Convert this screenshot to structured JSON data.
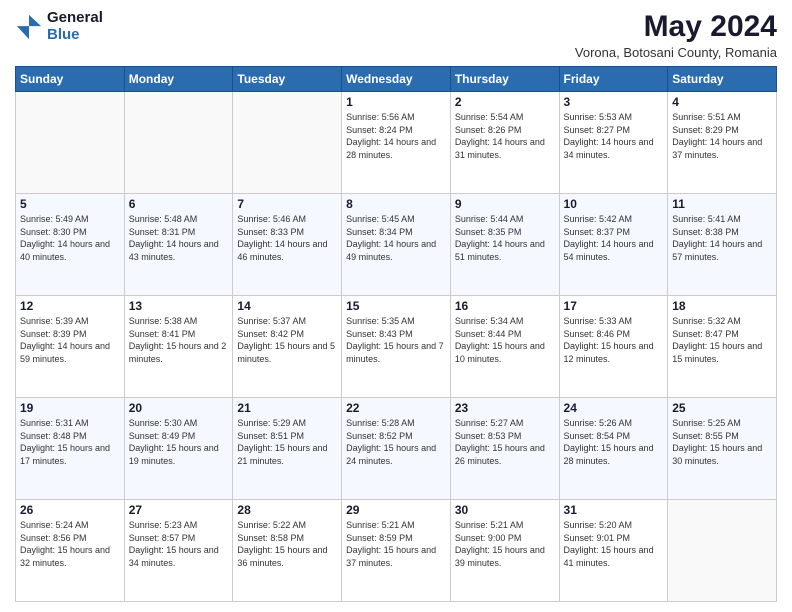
{
  "logo": {
    "general": "General",
    "blue": "Blue"
  },
  "header": {
    "month_year": "May 2024",
    "location": "Vorona, Botosani County, Romania"
  },
  "days_of_week": [
    "Sunday",
    "Monday",
    "Tuesday",
    "Wednesday",
    "Thursday",
    "Friday",
    "Saturday"
  ],
  "weeks": [
    [
      {
        "day": "",
        "info": ""
      },
      {
        "day": "",
        "info": ""
      },
      {
        "day": "",
        "info": ""
      },
      {
        "day": "1",
        "info": "Sunrise: 5:56 AM\nSunset: 8:24 PM\nDaylight: 14 hours and 28 minutes."
      },
      {
        "day": "2",
        "info": "Sunrise: 5:54 AM\nSunset: 8:26 PM\nDaylight: 14 hours and 31 minutes."
      },
      {
        "day": "3",
        "info": "Sunrise: 5:53 AM\nSunset: 8:27 PM\nDaylight: 14 hours and 34 minutes."
      },
      {
        "day": "4",
        "info": "Sunrise: 5:51 AM\nSunset: 8:29 PM\nDaylight: 14 hours and 37 minutes."
      }
    ],
    [
      {
        "day": "5",
        "info": "Sunrise: 5:49 AM\nSunset: 8:30 PM\nDaylight: 14 hours and 40 minutes."
      },
      {
        "day": "6",
        "info": "Sunrise: 5:48 AM\nSunset: 8:31 PM\nDaylight: 14 hours and 43 minutes."
      },
      {
        "day": "7",
        "info": "Sunrise: 5:46 AM\nSunset: 8:33 PM\nDaylight: 14 hours and 46 minutes."
      },
      {
        "day": "8",
        "info": "Sunrise: 5:45 AM\nSunset: 8:34 PM\nDaylight: 14 hours and 49 minutes."
      },
      {
        "day": "9",
        "info": "Sunrise: 5:44 AM\nSunset: 8:35 PM\nDaylight: 14 hours and 51 minutes."
      },
      {
        "day": "10",
        "info": "Sunrise: 5:42 AM\nSunset: 8:37 PM\nDaylight: 14 hours and 54 minutes."
      },
      {
        "day": "11",
        "info": "Sunrise: 5:41 AM\nSunset: 8:38 PM\nDaylight: 14 hours and 57 minutes."
      }
    ],
    [
      {
        "day": "12",
        "info": "Sunrise: 5:39 AM\nSunset: 8:39 PM\nDaylight: 14 hours and 59 minutes."
      },
      {
        "day": "13",
        "info": "Sunrise: 5:38 AM\nSunset: 8:41 PM\nDaylight: 15 hours and 2 minutes."
      },
      {
        "day": "14",
        "info": "Sunrise: 5:37 AM\nSunset: 8:42 PM\nDaylight: 15 hours and 5 minutes."
      },
      {
        "day": "15",
        "info": "Sunrise: 5:35 AM\nSunset: 8:43 PM\nDaylight: 15 hours and 7 minutes."
      },
      {
        "day": "16",
        "info": "Sunrise: 5:34 AM\nSunset: 8:44 PM\nDaylight: 15 hours and 10 minutes."
      },
      {
        "day": "17",
        "info": "Sunrise: 5:33 AM\nSunset: 8:46 PM\nDaylight: 15 hours and 12 minutes."
      },
      {
        "day": "18",
        "info": "Sunrise: 5:32 AM\nSunset: 8:47 PM\nDaylight: 15 hours and 15 minutes."
      }
    ],
    [
      {
        "day": "19",
        "info": "Sunrise: 5:31 AM\nSunset: 8:48 PM\nDaylight: 15 hours and 17 minutes."
      },
      {
        "day": "20",
        "info": "Sunrise: 5:30 AM\nSunset: 8:49 PM\nDaylight: 15 hours and 19 minutes."
      },
      {
        "day": "21",
        "info": "Sunrise: 5:29 AM\nSunset: 8:51 PM\nDaylight: 15 hours and 21 minutes."
      },
      {
        "day": "22",
        "info": "Sunrise: 5:28 AM\nSunset: 8:52 PM\nDaylight: 15 hours and 24 minutes."
      },
      {
        "day": "23",
        "info": "Sunrise: 5:27 AM\nSunset: 8:53 PM\nDaylight: 15 hours and 26 minutes."
      },
      {
        "day": "24",
        "info": "Sunrise: 5:26 AM\nSunset: 8:54 PM\nDaylight: 15 hours and 28 minutes."
      },
      {
        "day": "25",
        "info": "Sunrise: 5:25 AM\nSunset: 8:55 PM\nDaylight: 15 hours and 30 minutes."
      }
    ],
    [
      {
        "day": "26",
        "info": "Sunrise: 5:24 AM\nSunset: 8:56 PM\nDaylight: 15 hours and 32 minutes."
      },
      {
        "day": "27",
        "info": "Sunrise: 5:23 AM\nSunset: 8:57 PM\nDaylight: 15 hours and 34 minutes."
      },
      {
        "day": "28",
        "info": "Sunrise: 5:22 AM\nSunset: 8:58 PM\nDaylight: 15 hours and 36 minutes."
      },
      {
        "day": "29",
        "info": "Sunrise: 5:21 AM\nSunset: 8:59 PM\nDaylight: 15 hours and 37 minutes."
      },
      {
        "day": "30",
        "info": "Sunrise: 5:21 AM\nSunset: 9:00 PM\nDaylight: 15 hours and 39 minutes."
      },
      {
        "day": "31",
        "info": "Sunrise: 5:20 AM\nSunset: 9:01 PM\nDaylight: 15 hours and 41 minutes."
      },
      {
        "day": "",
        "info": ""
      }
    ]
  ]
}
